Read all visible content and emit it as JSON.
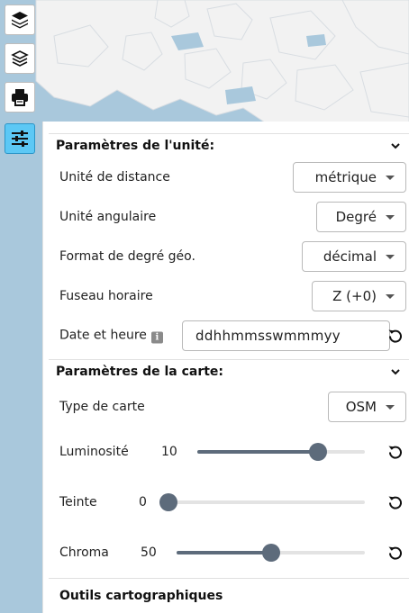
{
  "toolbar": {
    "buttons": [
      {
        "icon": "layers-icon",
        "active": false
      },
      {
        "icon": "layers-outline-icon",
        "active": false
      },
      {
        "icon": "print-icon",
        "active": false
      },
      {
        "icon": "sliders-icon",
        "active": true
      }
    ]
  },
  "colors": {
    "water": "#a9c8dc",
    "land": "#f2f2f2",
    "active_button": "#5cc8f5",
    "slider": "#5d6b7b"
  },
  "unit_settings": {
    "title": "Paramètres de l'unité:",
    "distance": {
      "label": "Unité de distance",
      "value": "métrique"
    },
    "angular": {
      "label": "Unité angulaire",
      "value": "Degré"
    },
    "geo_format": {
      "label": "Format de degré géo.",
      "value": "décimal"
    },
    "timezone": {
      "label": "Fuseau horaire",
      "value": "Z (+0)"
    },
    "datetime": {
      "label": "Date et heure",
      "info": "i",
      "value": "ddhhmmsswmmmyy"
    }
  },
  "map_settings": {
    "title": "Paramètres de la carte:",
    "map_type": {
      "label": "Type de carte",
      "value": "OSM"
    },
    "brightness": {
      "label": "Luminosité",
      "value": "10",
      "level": 0.72
    },
    "hue": {
      "label": "Teinte",
      "value": "0",
      "level": 0.0
    },
    "chroma": {
      "label": "Chroma",
      "value": "50",
      "level": 0.5
    }
  },
  "tools_section": {
    "title": "Outils cartographiques"
  }
}
